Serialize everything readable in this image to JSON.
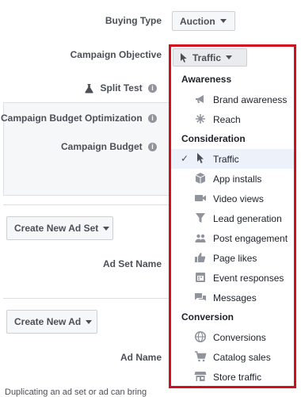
{
  "form": {
    "buying_type_label": "Buying Type",
    "buying_type_value": "Auction",
    "campaign_objective_label": "Campaign Objective",
    "split_test_label": "Split Test",
    "cbo_label": "Campaign Budget Optimization",
    "campaign_budget_label": "Campaign Budget",
    "create_ad_set_button": "Create New Ad Set",
    "ad_set_name_label": "Ad Set Name",
    "create_ad_button": "Create New Ad",
    "ad_name_label": "Ad Name",
    "bottom_text": "Duplicating an ad set or ad can bring"
  },
  "dropdown": {
    "selected": "Traffic",
    "sections": [
      {
        "title": "Awareness",
        "items": [
          {
            "label": "Brand awareness",
            "icon": "megaphone-icon"
          },
          {
            "label": "Reach",
            "icon": "asterisk-icon"
          }
        ]
      },
      {
        "title": "Consideration",
        "items": [
          {
            "label": "Traffic",
            "icon": "cursor-icon",
            "selected": true
          },
          {
            "label": "App installs",
            "icon": "box-icon"
          },
          {
            "label": "Video views",
            "icon": "video-camera-icon"
          },
          {
            "label": "Lead generation",
            "icon": "funnel-icon"
          },
          {
            "label": "Post engagement",
            "icon": "people-icon"
          },
          {
            "label": "Page likes",
            "icon": "thumbs-up-icon"
          },
          {
            "label": "Event responses",
            "icon": "calendar-icon"
          },
          {
            "label": "Messages",
            "icon": "chat-bubbles-icon"
          }
        ]
      },
      {
        "title": "Conversion",
        "items": [
          {
            "label": "Conversions",
            "icon": "globe-icon"
          },
          {
            "label": "Catalog sales",
            "icon": "cart-icon"
          },
          {
            "label": "Store traffic",
            "icon": "store-icon"
          }
        ]
      }
    ]
  },
  "colors": {
    "highlight_border": "#d0101c",
    "selected_bg": "#edf2fa"
  }
}
